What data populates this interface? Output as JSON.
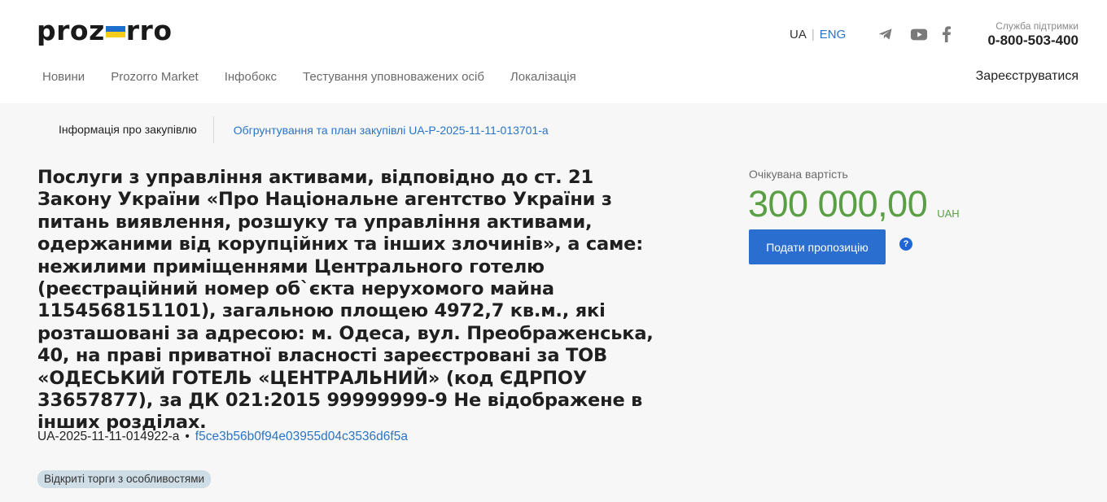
{
  "header": {
    "logo_left": "proz",
    "logo_right": "rro",
    "lang_ua": "UA",
    "lang_sep": "|",
    "lang_eng": "ENG",
    "support_label": "Служба підтримки",
    "support_phone": "0-800-503-400",
    "register_label": "Зареєструватися"
  },
  "nav": {
    "items": [
      "Новини",
      "Prozorro Market",
      "Інфобокс",
      "Тестування уповноважених осіб",
      "Локалізація"
    ]
  },
  "tabs": {
    "active": "Інформація про закупівлю",
    "link": "Обгрунтування та план закупівлі UA-P-2025-11-11-013701-a"
  },
  "tender": {
    "title": "Послуги з управління активами, відповідно до ст. 21 Закону України «Про Національне агентство України з питань ви­явлення, розшуку та управління активами, одержаними від корупційних та інших злочинів», а саме: нежилими приміщеннями Центрального готелю (реєстраційний но­мер об`єкта нерухомого майна 1154568151101), загальною площею 4972,7 кв.м., які розташовані за адресою: м. Одеса, вул. Преображенська, 40, на праві приватної власності заре­єстровані за ТОВ «ОДЕСЬКИЙ ГОТЕЛЬ «ЦЕНТРАЛЬНИЙ» (код ЄДРПОУ 33657877), за ДК 021:2015 99999999-9 Не відображене в інших розділах.",
    "id": "UA-2025-11-11-014922-a",
    "dot": "•",
    "hash": "f5ce3b56b0f94e03955d04c3536d6f5a",
    "procedure": "Відкриті торги з особливостями"
  },
  "value": {
    "label": "Очікувана вартість",
    "amount": "300 000,00",
    "currency": "UAH",
    "submit_label": "Подати пропозицію",
    "help": "?"
  },
  "colors": {
    "accent": "#2a6ed0",
    "link": "#2a74c7",
    "amount": "#5a9f45",
    "flag_blue": "#1b6fcf",
    "flag_yellow": "#f6cd1c"
  },
  "icons": [
    "telegram-icon",
    "youtube-icon",
    "facebook-icon",
    "help-icon"
  ]
}
